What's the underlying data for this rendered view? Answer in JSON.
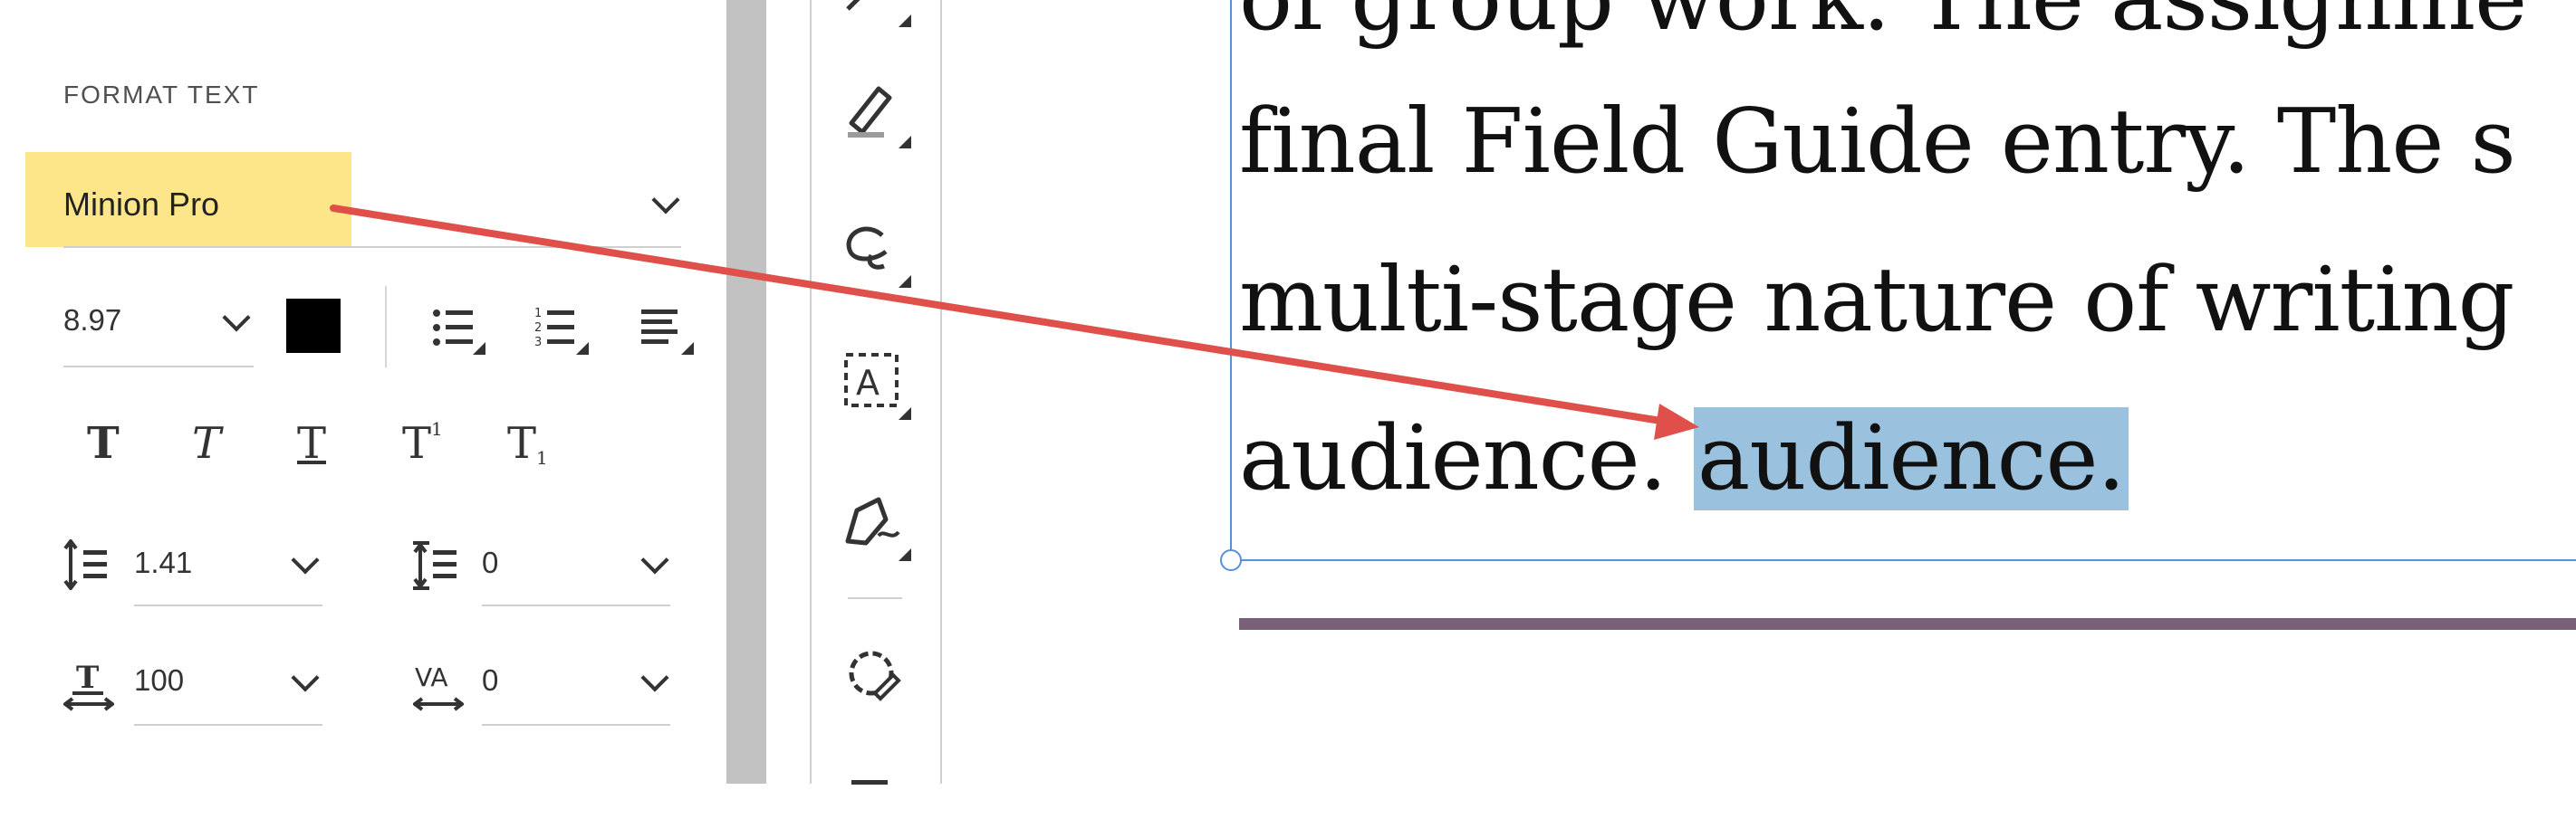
{
  "format_panel": {
    "section_title": "FORMAT TEXT",
    "font_family": "Minion Pro",
    "font_size": "8.97",
    "text_color": "#000000",
    "line_spacing": "1.41",
    "paragraph_spacing": "0",
    "horizontal_scale": "100",
    "char_spacing": "0",
    "list_buttons": [
      "bullet-list-icon",
      "numbered-list-icon",
      "align-icon"
    ],
    "style_buttons": [
      {
        "name": "bold",
        "glyph": "T"
      },
      {
        "name": "italic",
        "glyph": "T"
      },
      {
        "name": "underline",
        "glyph": "T"
      },
      {
        "name": "superscript",
        "glyph": "T",
        "mark": "1"
      },
      {
        "name": "subscript",
        "glyph": "T",
        "mark": "1"
      }
    ]
  },
  "tools": [
    "draw-icon",
    "highlighter-icon",
    "lasso-icon",
    "text-box-icon",
    "pen-sign-icon",
    "stamp-icon"
  ],
  "document": {
    "lines": [
      "of group work. The assignme",
      "final Field Guide entry. The s",
      "multi-stage nature of writing"
    ],
    "last_line_plain": "audience.",
    "last_line_selected": "audience."
  },
  "colors": {
    "highlight": "#fde68a",
    "selection": "#9ac1dd",
    "frame": "#5b8fd6",
    "arrow": "#e0504a",
    "divider_rule": "#7a5f78"
  }
}
